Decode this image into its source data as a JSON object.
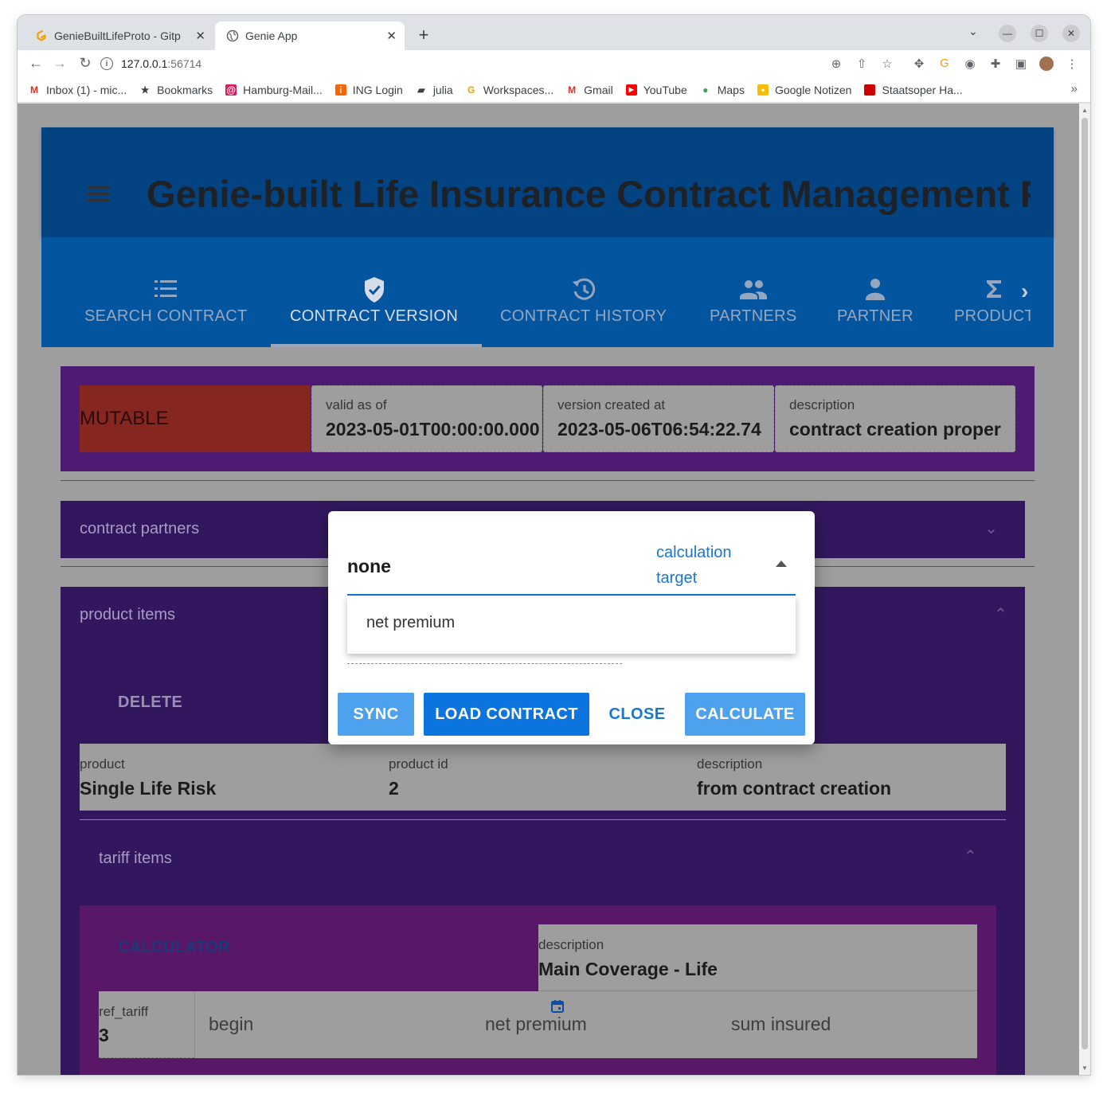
{
  "browser": {
    "tabs": [
      {
        "title": "GenieBuiltLifeProto - Gitp",
        "active": false
      },
      {
        "title": "Genie App",
        "active": true
      }
    ],
    "url_host": "127.0.0.1",
    "url_port": ":56714",
    "bookmarks": [
      {
        "label": "Inbox (1) - mic...",
        "icon": "gmail-icon"
      },
      {
        "label": "Bookmarks",
        "icon": "star-icon"
      },
      {
        "label": "Hamburg-Mail...",
        "icon": "mail-icon"
      },
      {
        "label": "ING Login",
        "icon": "ing-icon"
      },
      {
        "label": "julia",
        "icon": "folder-icon"
      },
      {
        "label": "Workspaces...",
        "icon": "gitpod-icon"
      },
      {
        "label": "Gmail",
        "icon": "gmail-icon"
      },
      {
        "label": "YouTube",
        "icon": "youtube-icon"
      },
      {
        "label": "Maps",
        "icon": "maps-icon"
      },
      {
        "label": "Google Notizen",
        "icon": "keep-icon"
      },
      {
        "label": "Staatsoper Ha...",
        "icon": "staatsoper-icon"
      }
    ]
  },
  "app": {
    "title": "Genie-built Life Insurance Contract Management P",
    "nav_tabs": [
      {
        "label": "SEARCH CONTRACT",
        "icon": "list-icon"
      },
      {
        "label": "CONTRACT VERSION",
        "icon": "verified-shield-icon",
        "active": true
      },
      {
        "label": "CONTRACT HISTORY",
        "icon": "history-icon"
      },
      {
        "label": "PARTNERS",
        "icon": "people-icon"
      },
      {
        "label": "PARTNER",
        "icon": "person-icon"
      },
      {
        "label": "PRODUCT",
        "icon": "sigma-icon"
      }
    ],
    "version": {
      "status": "MUTABLE",
      "valid_as_of_label": "valid as of",
      "valid_as_of": "2023-05-01T00:00:00.000",
      "created_label": "version created at",
      "created_at": "2023-05-06T06:54:22.74",
      "description_label": "description",
      "description": "contract creation proper"
    },
    "contract_partners_label": "contract partners",
    "product_items_label": "product items",
    "delete_label": "DELETE",
    "product": {
      "product_label": "product",
      "product_value": "Single Life Risk",
      "product_id_label": "product id",
      "product_id_value": "2",
      "description_label": "description",
      "description_value": "from contract creation"
    },
    "tariff_items_label": "tariff items",
    "calculator_label": "CALCULATOR",
    "tariff": {
      "description_label": "description",
      "description_value": "Main Coverage - Life",
      "ref_tariff_label": "ref_tariff",
      "ref_tariff_value": "3",
      "begin_placeholder": "begin",
      "net_premium_placeholder": "net premium",
      "sum_insured_placeholder": "sum insured"
    }
  },
  "dialog": {
    "select_value": "none",
    "select_label": "calculation target",
    "menu_options": [
      "net premium"
    ],
    "buttons": {
      "sync": "SYNC",
      "load_contract": "LOAD CONTRACT",
      "close": "CLOSE",
      "calculate": "CALCULATE"
    }
  },
  "colors": {
    "header_bg": "#034381",
    "tabs_bg": "#0355a0",
    "version_card_bg": "#4e1a73",
    "mutable_bg": "#86271f",
    "panel_bg": "#32175e",
    "tariff_card_bg": "#591768",
    "accent": "#1976d2"
  }
}
